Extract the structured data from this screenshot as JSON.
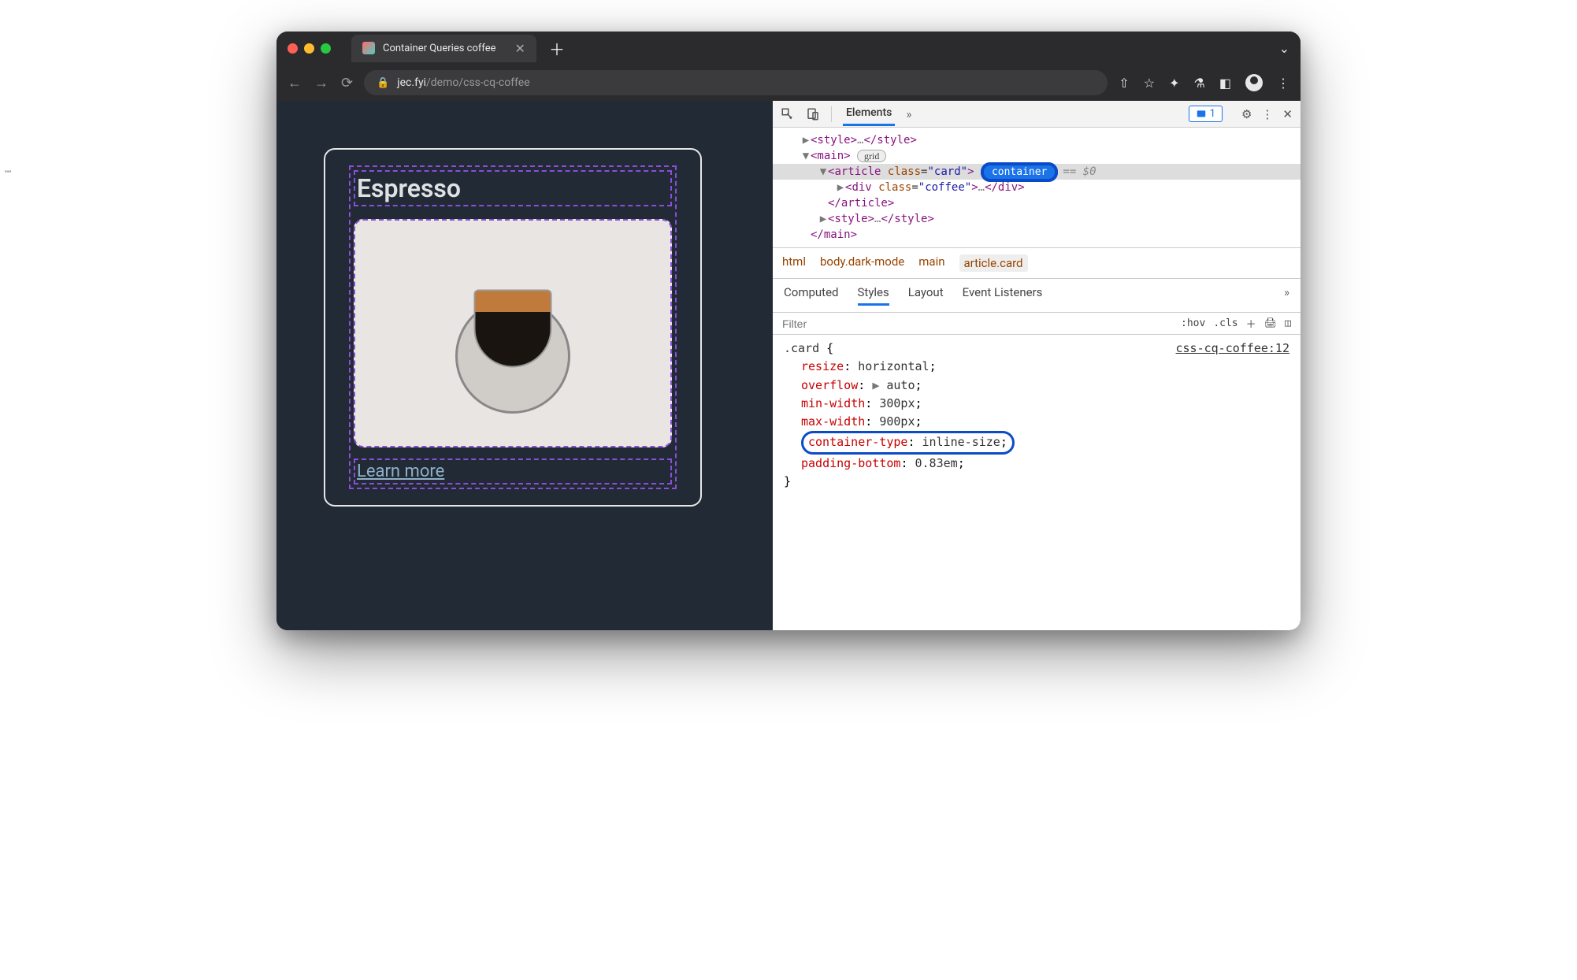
{
  "window": {
    "tab_title": "Container Queries coffee",
    "url_domain": "jec.fyi",
    "url_path": "/demo/css-cq-coffee"
  },
  "page": {
    "card_title": "Espresso",
    "learn_more": "Learn more"
  },
  "devtools": {
    "top_tabs": {
      "elements": "Elements"
    },
    "issues_count": "1",
    "dom": {
      "style_open": "<style>",
      "style_close": "</style>",
      "ellipsis": "…",
      "main_open": "<main>",
      "main_close": "</main>",
      "grid_badge": "grid",
      "article_tag": "article",
      "article_class_attr": "class",
      "article_class_val": "\"card\"",
      "container_badge": "container",
      "eq0": "== $0",
      "div_tag": "div",
      "div_class_val": "\"coffee\"",
      "article_close": "</article>"
    },
    "breadcrumb": [
      "html",
      "body.dark-mode",
      "main",
      "article.card"
    ],
    "styles_tabs": [
      "Computed",
      "Styles",
      "Layout",
      "Event Listeners"
    ],
    "filter_placeholder": "Filter",
    "filter_hov": ":hov",
    "filter_cls": ".cls",
    "css": {
      "selector": ".card",
      "file": "css-cq-coffee:12",
      "props": [
        {
          "p": "resize",
          "v": "horizontal"
        },
        {
          "p": "overflow",
          "v": "auto",
          "fold": true
        },
        {
          "p": "min-width",
          "v": "300px"
        },
        {
          "p": "max-width",
          "v": "900px"
        },
        {
          "p": "container-type",
          "v": "inline-size",
          "hl": true
        },
        {
          "p": "padding-bottom",
          "v": "0.83em"
        }
      ]
    }
  }
}
